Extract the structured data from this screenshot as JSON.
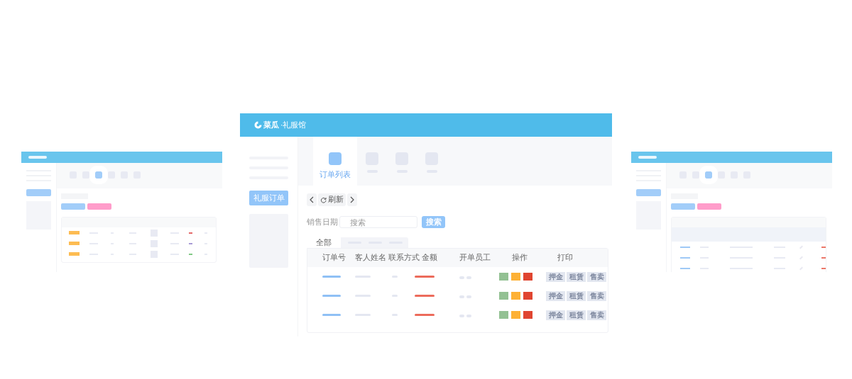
{
  "header": {
    "brand": "菜瓜",
    "subtitle": "·礼服馆"
  },
  "sidebar": {
    "menu_button": "礼服订单"
  },
  "tabs": [
    {
      "label": "订单列表",
      "selected": true
    },
    {
      "selected": false
    },
    {
      "selected": false
    },
    {
      "selected": false
    }
  ],
  "nav": {
    "refresh": "刷新"
  },
  "filter": {
    "label": "销售日期",
    "search_placeholder": "搜索",
    "search_button": "搜索"
  },
  "sub_tabs": [
    {
      "label": "全部",
      "selected": true
    },
    {
      "selected": false
    },
    {
      "selected": false
    },
    {
      "selected": false
    }
  ],
  "table": {
    "columns": [
      "订单号",
      "客人姓名",
      "联系方式",
      "金额",
      "开单员工",
      "操作",
      "打印"
    ],
    "rows": [
      {
        "actions": [
          {
            "color": "#93c193"
          },
          {
            "color": "#fdb135"
          },
          {
            "color": "#e04530"
          }
        ],
        "print_buttons": [
          "押金",
          "租赁",
          "售卖"
        ]
      },
      {
        "actions": [
          {
            "color": "#93c193"
          },
          {
            "color": "#fdb135"
          },
          {
            "color": "#e04530"
          }
        ],
        "print_buttons": [
          "押金",
          "租赁",
          "售卖"
        ]
      },
      {
        "actions": [
          {
            "color": "#93c193"
          },
          {
            "color": "#fdb135"
          },
          {
            "color": "#e04530"
          }
        ],
        "print_buttons": [
          "押金",
          "租赁",
          "售卖"
        ]
      }
    ]
  }
}
